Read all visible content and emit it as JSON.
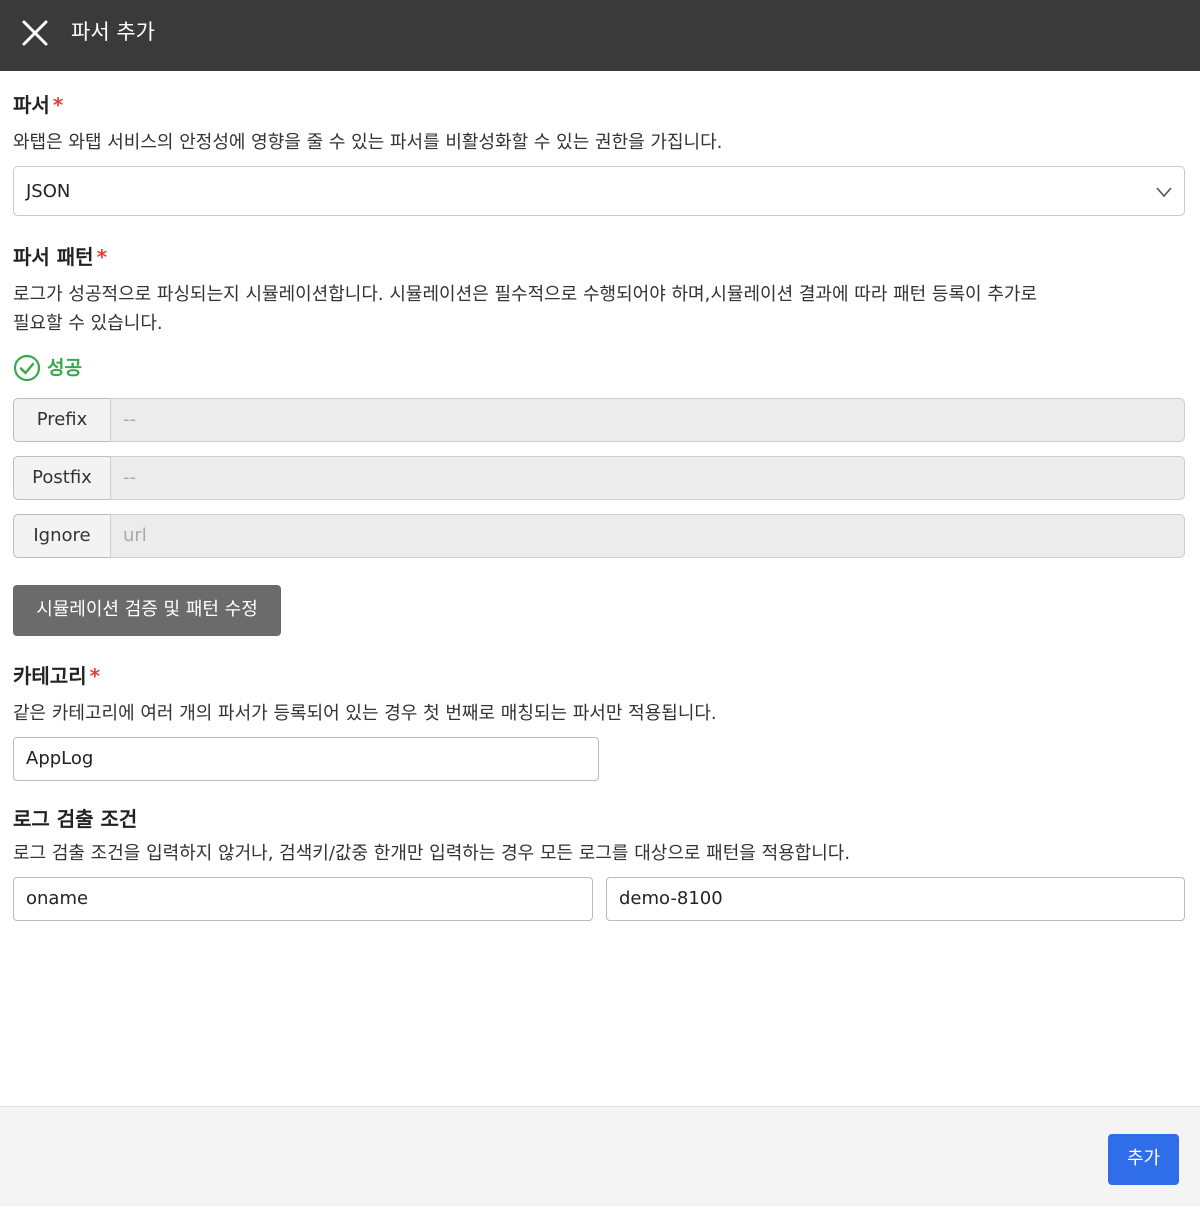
{
  "header": {
    "title": "파서 추가",
    "close_icon": "close-icon"
  },
  "parser": {
    "label": "파서",
    "required_mark": "*",
    "description": "와탭은 와탭 서비스의 안정성에 영향을 줄 수 있는 파서를 비활성화할 수 있는 권한을 가집니다.",
    "selected": "JSON",
    "dropdown_icon": "chevron-down-icon"
  },
  "pattern": {
    "label": "파서 패턴",
    "required_mark": "*",
    "description_line1": "로그가 성공적으로 파싱되는지 시뮬레이션합니다. 시뮬레이션은 필수적으로 수행되어야 하며,시뮬레이션 결과에 따라 패턴 등록이 추가로",
    "description_line2": "필요할 수 있습니다.",
    "status_text": "성공",
    "status_color": "#3aa84a",
    "rows": [
      {
        "tag": "Prefix",
        "value": "--"
      },
      {
        "tag": "Postfix",
        "value": "--"
      },
      {
        "tag": "Ignore",
        "value": "url"
      }
    ],
    "simulate_button": "시뮬레이션 검증 및 패턴 수정"
  },
  "category": {
    "label": "카테고리",
    "required_mark": "*",
    "description": "같은 카테고리에 여러 개의 파서가 등록되어 있는 경우 첫 번째로 매칭되는 파서만 적용됩니다.",
    "value": "AppLog"
  },
  "condition": {
    "label": "로그 검출 조건",
    "description": "로그 검출 조건을 입력하지 않거나, 검색키/값중 한개만 입력하는 경우 모든 로그를 대상으로 패턴을 적용합니다.",
    "key_value": "oname",
    "value_value": "demo-8100"
  },
  "footer": {
    "add_button": "추가",
    "accent_color": "#2f6ee8"
  }
}
